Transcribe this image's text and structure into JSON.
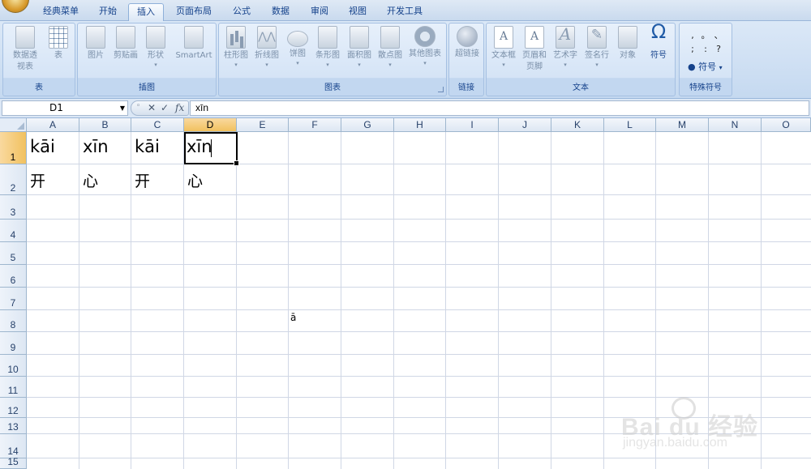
{
  "tabs": [
    "经典菜单",
    "开始",
    "插入",
    "页面布局",
    "公式",
    "数据",
    "审阅",
    "视图",
    "开发工具"
  ],
  "active_tab": "插入",
  "ribbon": {
    "groups": {
      "table": {
        "label": "表",
        "buttons": [
          "数据透视表",
          "表"
        ]
      },
      "illustrations": {
        "label": "插图",
        "buttons": [
          "图片",
          "剪贴画",
          "形状",
          "SmartArt"
        ]
      },
      "charts": {
        "label": "图表",
        "buttons": [
          "柱形图",
          "折线图",
          "饼图",
          "条形图",
          "面积图",
          "散点图",
          "其他图表"
        ]
      },
      "links": {
        "label": "链接",
        "buttons": [
          "超链接"
        ]
      },
      "text": {
        "label": "文本",
        "buttons": [
          "文本框",
          "页眉和页脚",
          "艺术字",
          "签名行",
          "对象",
          "符号"
        ]
      },
      "special": {
        "label": "特殊符号",
        "symbols": [
          ",",
          "。",
          "、",
          ";",
          ":",
          "?"
        ],
        "button": "符号"
      }
    }
  },
  "formula_bar": {
    "name_box": "D1",
    "fx": "fx",
    "value": "xīn"
  },
  "columns": [
    "A",
    "B",
    "C",
    "D",
    "E",
    "F",
    "G",
    "H",
    "I",
    "J",
    "K",
    "L",
    "M",
    "N",
    "O"
  ],
  "selected_column": "D",
  "rows": [
    "1",
    "2",
    "3",
    "4",
    "5",
    "6",
    "7",
    "8",
    "9",
    "10",
    "11",
    "12",
    "13",
    "14",
    "15"
  ],
  "cells": {
    "A1": "kāi",
    "B1": "xīn",
    "C1": "kāi",
    "D1": "xīn",
    "A2": "开",
    "B2": "心",
    "C2": "开",
    "D2": "心",
    "F8": "ā"
  },
  "watermark": {
    "main": "Bai du 经验",
    "sub": "jingyan.baidu.com"
  }
}
